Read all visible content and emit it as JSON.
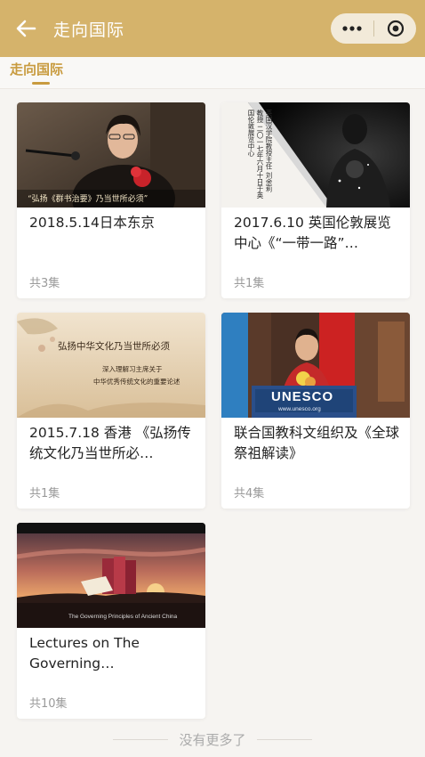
{
  "header": {
    "title": "走向国际",
    "accent_color": "#d5b36b"
  },
  "tabs": [
    {
      "label": "走向国际",
      "active": true
    }
  ],
  "cards": [
    {
      "title": "2018.5.14日本东京",
      "count": "共3集",
      "thumb_caption": "“弘扬《群书治要》乃当世所必须”"
    },
    {
      "title": "2017.6.10 英国伦敦展览中心《“一带一路”…",
      "count": "共1集",
      "thumb_caption": "英国汉学院教授主任 刘余莉 教授 二〇一七年六月十日于英国伦敦展览中心"
    },
    {
      "title": "2015.7.18 香港 《弘扬传统文化乃当世所必…",
      "count": "共1集",
      "thumb_caption_1": "弘扬中华文化乃当世所必须",
      "thumb_caption_2": "深入理解习主席关于",
      "thumb_caption_3": "中华优秀传统文化的重要论述"
    },
    {
      "title": "联合国教科文组织及《全球祭祖解读》",
      "count": "共4集",
      "thumb_logo": "UNESCO",
      "thumb_url": "www.unesco.org"
    },
    {
      "title": "Lectures on The Governing…",
      "count": "共10集",
      "thumb_caption": "The Governing Principles of Ancient China"
    }
  ],
  "footer": {
    "no_more": "没有更多了"
  }
}
